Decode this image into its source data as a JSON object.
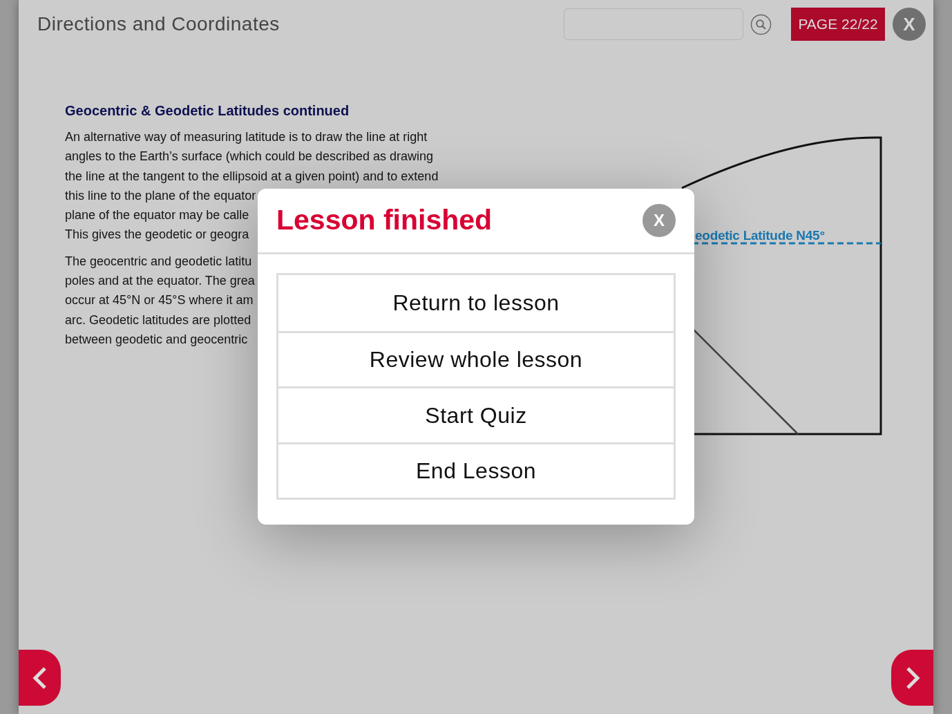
{
  "header": {
    "title": "Directions and Coordinates",
    "page_indicator": "PAGE 22/22",
    "close_label": "X"
  },
  "content": {
    "heading": "Geocentric & Geodetic Latitudes continued",
    "paragraphs": [
      {
        "lines": [
          "An alternative way of measuring latitude is to draw the line at right",
          "angles to the Earth’s surface (which could be described as drawing",
          "the line at the tangent to the ellipsoid at a given point) and to extend",
          "this line to the plane of the equator",
          "plane of the equator may be calle",
          "This gives the geodetic or geogra"
        ]
      },
      {
        "lines": [
          "The geocentric and geodetic latitu",
          "poles and at the equator. The grea",
          "occur at 45°N or 45°S where it am",
          "arc. Geodetic latitudes are plotted",
          "between geodetic and geocentric"
        ]
      }
    ]
  },
  "diagram": {
    "label": "eodetic Latitude N45°"
  },
  "dialog": {
    "title": "Lesson finished",
    "close_label": "X",
    "options": [
      "Return to lesson",
      "Review whole lesson",
      "Start Quiz",
      "End Lesson"
    ]
  }
}
